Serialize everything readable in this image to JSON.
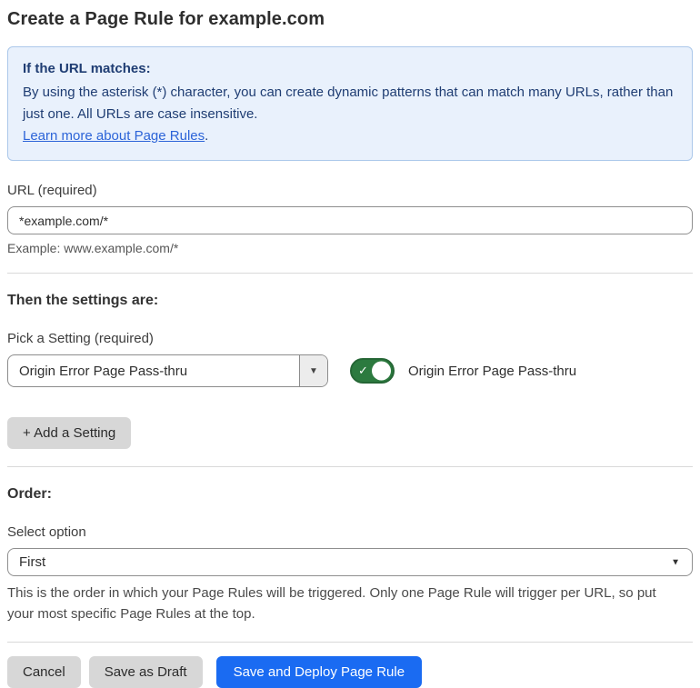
{
  "page": {
    "title": "Create a Page Rule for example.com"
  },
  "info_box": {
    "heading": "If the URL matches:",
    "body": "By using the asterisk (*) character, you can create dynamic patterns that can match many URLs, rather than just one. All URLs are case insensitive.",
    "link_label": "Learn more about Page Rules",
    "link_suffix": "."
  },
  "url_field": {
    "label": "URL (required)",
    "value": "*example.com/*",
    "helper": "Example: www.example.com/*"
  },
  "settings_section": {
    "heading": "Then the settings are:",
    "picker_label": "Pick a Setting (required)",
    "picker_value": "Origin Error Page Pass-thru",
    "picker_caret": "▼",
    "toggle_state": "on",
    "toggle_check": "✓",
    "toggle_label": "Origin Error Page Pass-thru",
    "add_setting_label": "+ Add a Setting"
  },
  "order_section": {
    "heading": "Order:",
    "select_label": "Select option",
    "select_value": "First",
    "select_caret": "▼",
    "helper": "This is the order in which your Page Rules will be triggered. Only one Page Rule will trigger per URL, so put your most specific Page Rules at the top."
  },
  "footer": {
    "cancel_label": "Cancel",
    "save_draft_label": "Save as Draft",
    "save_deploy_label": "Save and Deploy Page Rule"
  },
  "colors": {
    "info_bg": "#e9f1fc",
    "info_border": "#abc8ea",
    "info_text": "#1f3d73",
    "link_blue": "#2c64d8",
    "toggle_green": "#2c7a3f",
    "primary_blue": "#1a6bf2",
    "button_gray": "#d7d7d7"
  }
}
